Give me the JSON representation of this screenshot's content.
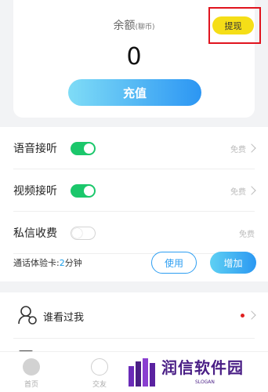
{
  "balance": {
    "label": "余额",
    "unit": "(聊币)",
    "amount": "0",
    "recharge_label": "充值",
    "withdraw_label": "提现"
  },
  "settings": {
    "rows": [
      {
        "label": "语音接听",
        "toggle": "on",
        "price": "免费"
      },
      {
        "label": "视频接听",
        "toggle": "on",
        "price": "免费"
      },
      {
        "label": "私信收费",
        "toggle": "off",
        "price": "免费"
      }
    ],
    "trial": {
      "prefix": "通话体验卡:",
      "value": "2",
      "suffix": "分钟",
      "use_label": "使用",
      "add_label": "增加"
    }
  },
  "visitors": {
    "label": "谁看过我",
    "has_new": true
  },
  "tabbar": {
    "tabs": [
      {
        "label": "首页",
        "icon": "home-icon"
      },
      {
        "label": "交友",
        "icon": "discover-icon"
      }
    ]
  },
  "watermark": {
    "text": "润信软件园",
    "slogan": "SLOGAN"
  },
  "colors": {
    "accent_blue": "#2b98f2",
    "toggle_on": "#1bc76b",
    "withdraw_yellow": "#f5de17",
    "highlight_red": "#e0141e"
  }
}
